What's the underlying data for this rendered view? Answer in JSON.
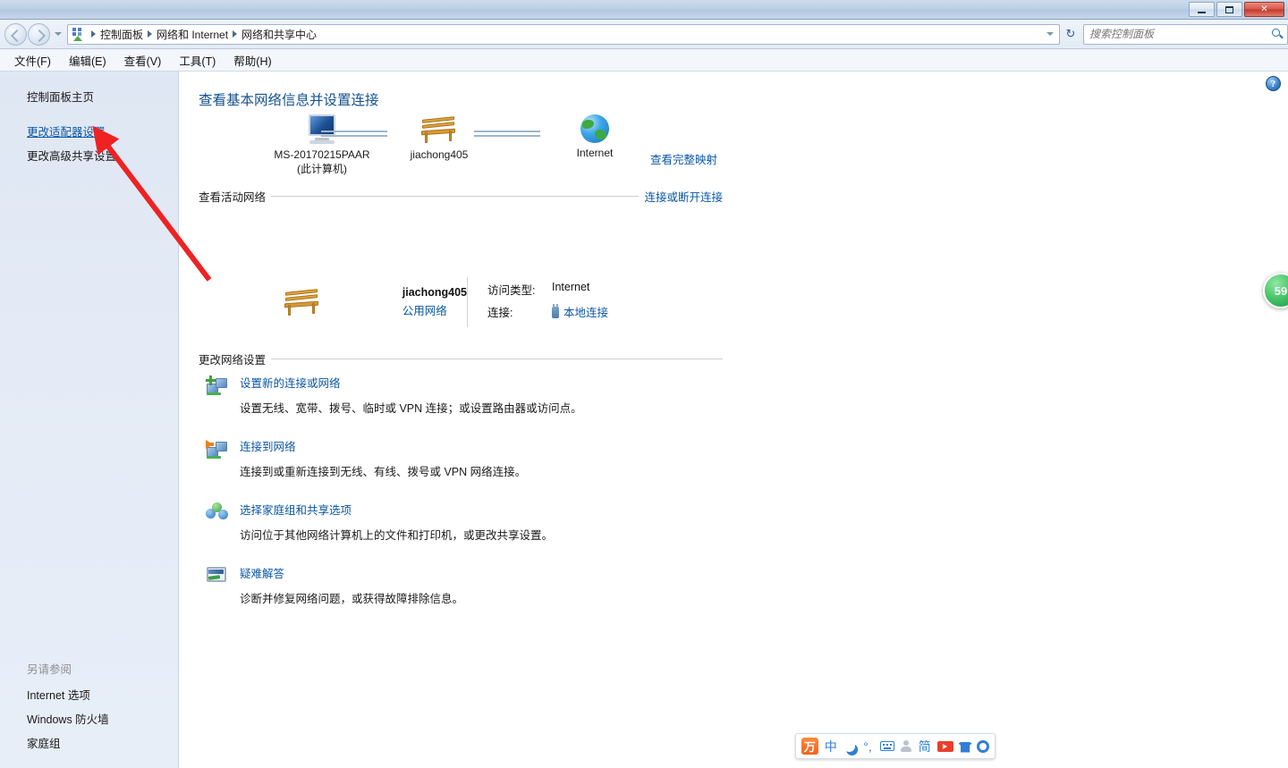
{
  "window": {
    "minimize_label": "最小化",
    "maximize_label": "最大化",
    "close_label": "关闭"
  },
  "address_bar": {
    "icon": "control-panel-icon",
    "breadcrumbs": [
      "控制面板",
      "网络和 Internet",
      "网络和共享中心"
    ],
    "refresh_icon": "refresh-icon",
    "dropdown_icon": "chevron-down-icon"
  },
  "search": {
    "placeholder": "搜索控制面板",
    "value": "",
    "icon": "search-icon"
  },
  "menubar": {
    "items": [
      {
        "label": "文件(F)"
      },
      {
        "label": "编辑(E)"
      },
      {
        "label": "查看(V)"
      },
      {
        "label": "工具(T)"
      },
      {
        "label": "帮助(H)"
      }
    ]
  },
  "sidebar": {
    "top_items": [
      {
        "label": "控制面板主页",
        "state": "normal"
      },
      {
        "label": "更改适配器设置",
        "state": "hover-link"
      },
      {
        "label": "更改高级共享设置",
        "state": "normal"
      }
    ],
    "see_also_heading": "另请参阅",
    "see_also_items": [
      {
        "label": "Internet 选项"
      },
      {
        "label": "Windows 防火墙"
      },
      {
        "label": "家庭组"
      }
    ]
  },
  "content": {
    "help_icon": "help-icon",
    "page_title": "查看基本网络信息并设置连接",
    "network_map": {
      "computer": {
        "name": "MS-20170215PAAR",
        "sub": "(此计算机)",
        "icon": "monitor-icon"
      },
      "network": {
        "name": "jiachong405",
        "icon": "bench-icon"
      },
      "internet": {
        "name": "Internet",
        "icon": "globe-icon"
      },
      "view_full_map": "查看完整映射"
    },
    "active_networks": {
      "heading": "查看活动网络",
      "action_link": "连接或断开连接",
      "entry": {
        "icon": "bench-icon",
        "name": "jiachong405",
        "type": "公用网络",
        "access_type_label": "访问类型:",
        "access_type_value": "Internet",
        "connection_label": "连接:",
        "connection_value": "本地连接",
        "connection_icon": "network-plug-icon"
      }
    },
    "change_settings": {
      "heading": "更改网络设置",
      "tasks": [
        {
          "icon": "new-connection-icon",
          "title": "设置新的连接或网络",
          "desc": "设置无线、宽带、拨号、临时或 VPN 连接；或设置路由器或访问点。"
        },
        {
          "icon": "connect-network-icon",
          "title": "连接到网络",
          "desc": "连接到或重新连接到无线、有线、拨号或 VPN 网络连接。"
        },
        {
          "icon": "homegroup-icon",
          "title": "选择家庭组和共享选项",
          "desc": "访问位于其他网络计算机上的文件和打印机，或更改共享设置。"
        },
        {
          "icon": "troubleshoot-icon",
          "title": "疑难解答",
          "desc": "诊断并修复网络问题，或获得故障排除信息。"
        }
      ]
    }
  },
  "overlays": {
    "green_badge": {
      "value": "59",
      "color": "#3fbf62"
    },
    "annotation_arrow": {
      "color": "#ee2222",
      "points_at": "更改适配器设置"
    }
  },
  "ime_toolbar": {
    "logo": "搜狗输入法logo",
    "items": [
      {
        "icon": "ime-logo-icon",
        "label": "万"
      },
      {
        "icon": "chinese-mode-icon",
        "label": "中"
      },
      {
        "icon": "moon-icon",
        "label": ""
      },
      {
        "icon": "punctuation-icon",
        "label": "°,"
      },
      {
        "icon": "keyboard-icon",
        "label": ""
      },
      {
        "icon": "person-icon",
        "label": ""
      },
      {
        "icon": "simplified-icon",
        "label": "简"
      },
      {
        "icon": "video-icon",
        "label": ""
      },
      {
        "icon": "skin-shirt-icon",
        "label": ""
      },
      {
        "icon": "gear-icon",
        "label": ""
      }
    ]
  },
  "colors": {
    "link": "#0b57a4",
    "title": "#15528f",
    "titlebar": "#b2c7e0",
    "sidebar_bg": "#e4ebf6",
    "annotation_red": "#ee2222"
  }
}
